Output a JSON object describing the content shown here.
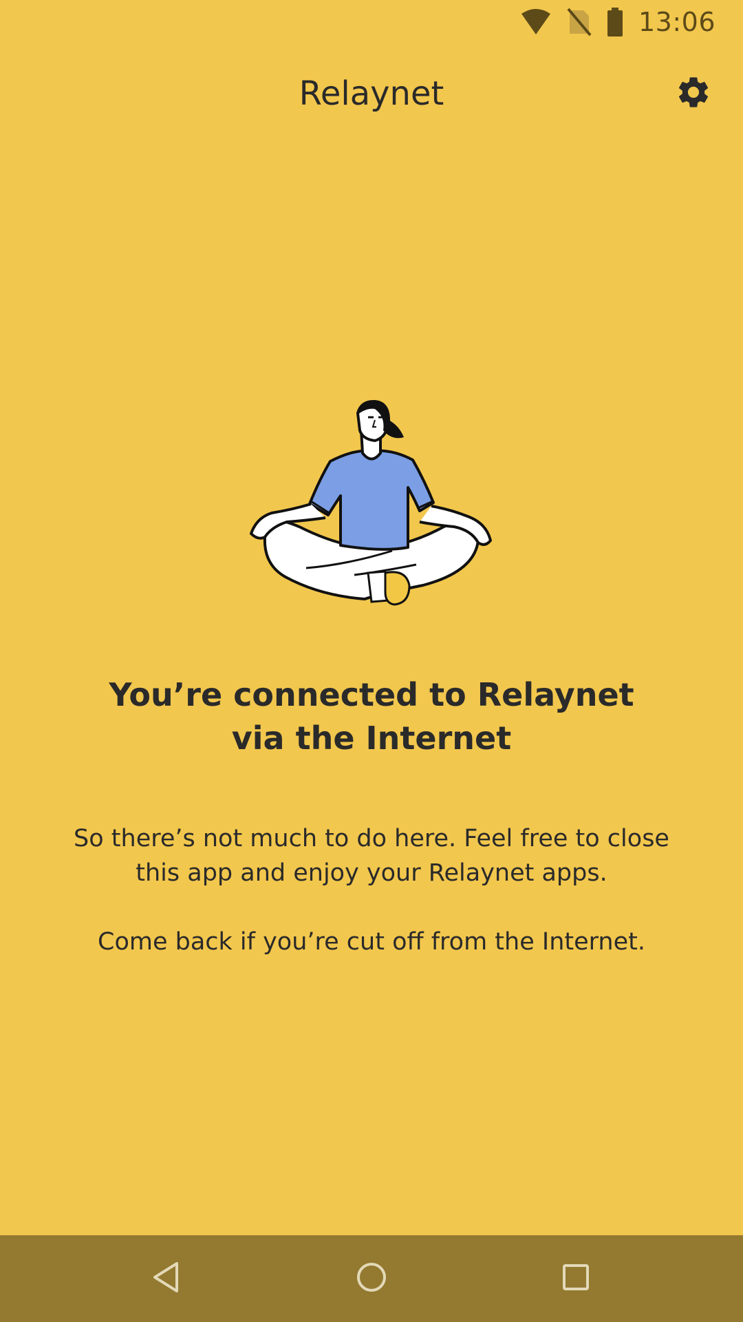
{
  "status_bar": {
    "time": "13:06",
    "icons": [
      "wifi-icon",
      "no-sim-icon",
      "battery-icon"
    ]
  },
  "app_bar": {
    "title": "Relaynet",
    "settings_icon": "gear-icon"
  },
  "main": {
    "illustration": "person-meditating-illustration",
    "headline_line1": "You’re connected to Relaynet",
    "headline_line2": "via the Internet",
    "body_line1": "So there’s not much to do here. Feel free to close",
    "body_line2": "this app and enjoy your Relaynet apps.",
    "body_line3": "Come back if you’re cut off from the Internet."
  },
  "nav_bar": {
    "buttons": [
      "back-icon",
      "home-icon",
      "recents-icon"
    ]
  },
  "colors": {
    "background": "#F2C74D",
    "nav_bar": "#937A30",
    "text": "#2A2A2A",
    "shirt": "#7B9EE5"
  }
}
